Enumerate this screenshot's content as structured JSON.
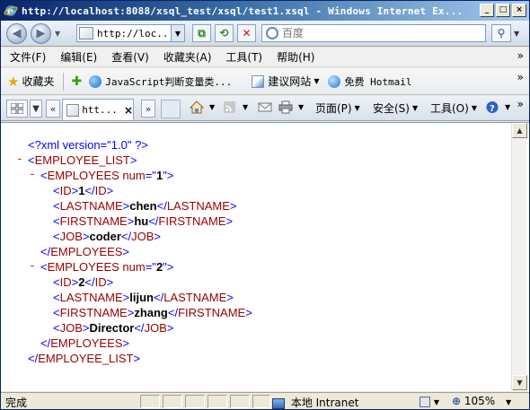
{
  "window": {
    "title": "http://localhost:8088/xsql_test/xsql/test1.xsql - Windows Internet Ex...",
    "minimize": "_",
    "maximize": "□",
    "close": "×"
  },
  "address": {
    "url": "http://loc...",
    "search_placeholder": "百度"
  },
  "menu": [
    "文件(F)",
    "编辑(E)",
    "查看(V)",
    "收藏夹(A)",
    "工具(T)",
    "帮助(H)"
  ],
  "favorites": {
    "label": "收藏夹",
    "items": [
      {
        "label": "JavaScript判断变量类...",
        "icon": "globe-icon"
      },
      {
        "label": "建议网站",
        "icon": "page-icon",
        "has_dropdown": true
      },
      {
        "label": "免费 Hotmail",
        "icon": "ie-icon"
      }
    ]
  },
  "tabs": {
    "active_title": "htt...",
    "close": "×"
  },
  "commands": {
    "page": "页面(P)",
    "safety": "安全(S)",
    "tools": "工具(O)"
  },
  "xml_lines": [
    {
      "indent": 0,
      "collapse": false,
      "kind": "pi",
      "text": "<?xml version=\"1.0\" ?>"
    },
    {
      "indent": 0,
      "collapse": true,
      "kind": "open",
      "tag": "EMPLOYEE_LIST"
    },
    {
      "indent": 1,
      "collapse": true,
      "kind": "open_attr",
      "tag": "EMPLOYEES",
      "attr": "num",
      "value": "1"
    },
    {
      "indent": 2,
      "collapse": false,
      "kind": "leaf",
      "tag": "ID",
      "text": "1"
    },
    {
      "indent": 2,
      "collapse": false,
      "kind": "leaf",
      "tag": "LASTNAME",
      "text": "chen"
    },
    {
      "indent": 2,
      "collapse": false,
      "kind": "leaf",
      "tag": "FIRSTNAME",
      "text": "hu"
    },
    {
      "indent": 2,
      "collapse": false,
      "kind": "leaf",
      "tag": "JOB",
      "text": "coder"
    },
    {
      "indent": 1,
      "collapse": false,
      "kind": "close",
      "tag": "EMPLOYEES"
    },
    {
      "indent": 1,
      "collapse": true,
      "kind": "open_attr",
      "tag": "EMPLOYEES",
      "attr": "num",
      "value": "2"
    },
    {
      "indent": 2,
      "collapse": false,
      "kind": "leaf",
      "tag": "ID",
      "text": "2"
    },
    {
      "indent": 2,
      "collapse": false,
      "kind": "leaf",
      "tag": "LASTNAME",
      "text": "lijun"
    },
    {
      "indent": 2,
      "collapse": false,
      "kind": "leaf",
      "tag": "FIRSTNAME",
      "text": "zhang"
    },
    {
      "indent": 2,
      "collapse": false,
      "kind": "leaf",
      "tag": "JOB",
      "text": "Director"
    },
    {
      "indent": 1,
      "collapse": false,
      "kind": "close",
      "tag": "EMPLOYEES"
    },
    {
      "indent": 0,
      "collapse": false,
      "kind": "close",
      "tag": "EMPLOYEE_LIST"
    }
  ],
  "status": {
    "text": "完成",
    "zone": "本地 Intranet",
    "zoom": "105%"
  },
  "colors": {
    "tag": "#990000",
    "value": "#0000ff",
    "collapse": "#ff0000"
  }
}
